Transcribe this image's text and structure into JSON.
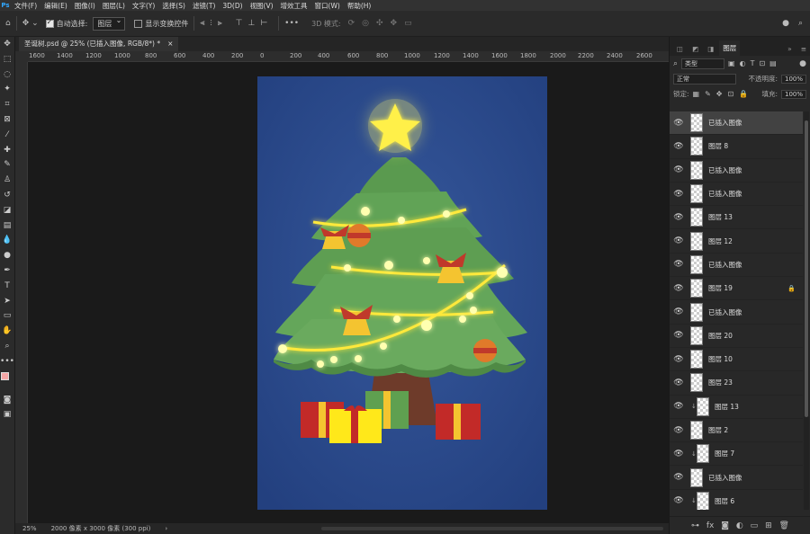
{
  "menu": {
    "app_icon": "Ps",
    "items": [
      "文件(F)",
      "编辑(E)",
      "图像(I)",
      "图层(L)",
      "文字(Y)",
      "选择(S)",
      "滤镜(T)",
      "3D(D)",
      "视图(V)",
      "增效工具",
      "窗口(W)",
      "帮助(H)"
    ],
    "window_controls": [
      "—",
      "▢",
      "✕"
    ]
  },
  "options": {
    "auto_select_label": "自动选择:",
    "auto_select_value": "图层",
    "show_transform_label": "显示变换控件",
    "mode_3d_label": "3D 模式:"
  },
  "doc_tab": {
    "title": "圣诞树.psd @ 25% (已插入图像, RGB/8*) *",
    "close": "×"
  },
  "ruler_ticks": [
    "1600",
    "1400",
    "1200",
    "1000",
    "800",
    "600",
    "400",
    "200",
    "0",
    "200",
    "400",
    "600",
    "800",
    "1000",
    "1200",
    "1400",
    "1600",
    "1800",
    "2000",
    "2200",
    "2400",
    "2600"
  ],
  "status": {
    "zoom": "25%",
    "doc_info": "2000 像素 x 3000 像素 (300 ppi)",
    "arrow": "›"
  },
  "panel": {
    "tabs": [
      "图层"
    ],
    "filter_label": "类型",
    "blend_mode": "正常",
    "opacity_label": "不透明度:",
    "opacity_value": "100%",
    "lock_label": "锁定:",
    "fill_label": "填充:",
    "fill_value": "100%",
    "layers": [
      {
        "name": "已插入图像",
        "selected": true,
        "clip": false,
        "locked": false
      },
      {
        "name": "图层 8",
        "selected": false,
        "clip": false,
        "locked": false
      },
      {
        "name": "已插入图像",
        "selected": false,
        "clip": false,
        "locked": false
      },
      {
        "name": "已插入图像",
        "selected": false,
        "clip": false,
        "locked": false
      },
      {
        "name": "图层 13",
        "selected": false,
        "clip": false,
        "locked": false
      },
      {
        "name": "图层 12",
        "selected": false,
        "clip": false,
        "locked": false
      },
      {
        "name": "已插入图像",
        "selected": false,
        "clip": false,
        "locked": false
      },
      {
        "name": "图层 19",
        "selected": false,
        "clip": false,
        "locked": true
      },
      {
        "name": "已插入图像",
        "selected": false,
        "clip": false,
        "locked": false
      },
      {
        "name": "图层 20",
        "selected": false,
        "clip": false,
        "locked": false
      },
      {
        "name": "图层 10",
        "selected": false,
        "clip": false,
        "locked": false
      },
      {
        "name": "图层 23",
        "selected": false,
        "clip": false,
        "locked": false
      },
      {
        "name": "图层 13",
        "selected": false,
        "clip": true,
        "locked": false
      },
      {
        "name": "图层 2",
        "selected": false,
        "clip": false,
        "locked": false
      },
      {
        "name": "图层 7",
        "selected": false,
        "clip": true,
        "locked": false
      },
      {
        "name": "已插入图像",
        "selected": false,
        "clip": false,
        "locked": false
      },
      {
        "name": "图层 6",
        "selected": false,
        "clip": true,
        "locked": false
      }
    ],
    "footer_icons": [
      "link-icon",
      "fx-icon",
      "mask-icon",
      "adjustment-icon",
      "folder-icon",
      "new-layer-icon",
      "trash-icon"
    ]
  },
  "colors": {
    "accent": "#31a8ff",
    "artboard_bg": "#2b4a8c",
    "foreground_swatch": "#f4a6a6",
    "background_swatch": "#ffffff"
  }
}
